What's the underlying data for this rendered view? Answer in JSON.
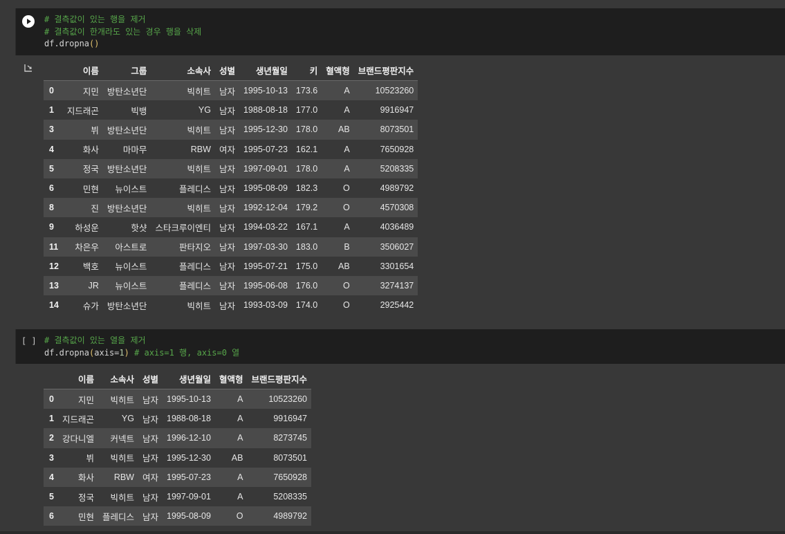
{
  "cell1": {
    "code": [
      {
        "parts": [
          {
            "t": "# 결측값이 있는 행을 제거",
            "c": "c-comment"
          }
        ]
      },
      {
        "parts": [
          {
            "t": "# 결측값이 한개라도 있는 경우 행을 삭제",
            "c": "c-comment"
          }
        ]
      },
      {
        "parts": [
          {
            "t": "df.dropna",
            "c": "c-plain"
          },
          {
            "t": "()",
            "c": "c-paren"
          }
        ]
      }
    ]
  },
  "table1": {
    "columns": [
      "",
      "이름",
      "그룹",
      "소속사",
      "성별",
      "생년월일",
      "키",
      "혈액형",
      "브랜드평판지수"
    ],
    "rows": [
      [
        "0",
        "지민",
        "방탄소년단",
        "빅히트",
        "남자",
        "1995-10-13",
        "173.6",
        "A",
        "10523260"
      ],
      [
        "1",
        "지드래곤",
        "빅뱅",
        "YG",
        "남자",
        "1988-08-18",
        "177.0",
        "A",
        "9916947"
      ],
      [
        "3",
        "뷔",
        "방탄소년단",
        "빅히트",
        "남자",
        "1995-12-30",
        "178.0",
        "AB",
        "8073501"
      ],
      [
        "4",
        "화사",
        "마마무",
        "RBW",
        "여자",
        "1995-07-23",
        "162.1",
        "A",
        "7650928"
      ],
      [
        "5",
        "정국",
        "방탄소년단",
        "빅히트",
        "남자",
        "1997-09-01",
        "178.0",
        "A",
        "5208335"
      ],
      [
        "6",
        "민현",
        "뉴이스트",
        "플레디스",
        "남자",
        "1995-08-09",
        "182.3",
        "O",
        "4989792"
      ],
      [
        "8",
        "진",
        "방탄소년단",
        "빅히트",
        "남자",
        "1992-12-04",
        "179.2",
        "O",
        "4570308"
      ],
      [
        "9",
        "하성운",
        "핫샷",
        "스타크루이엔티",
        "남자",
        "1994-03-22",
        "167.1",
        "A",
        "4036489"
      ],
      [
        "11",
        "차은우",
        "아스트로",
        "판타지오",
        "남자",
        "1997-03-30",
        "183.0",
        "B",
        "3506027"
      ],
      [
        "12",
        "백호",
        "뉴이스트",
        "플레디스",
        "남자",
        "1995-07-21",
        "175.0",
        "AB",
        "3301654"
      ],
      [
        "13",
        "JR",
        "뉴이스트",
        "플레디스",
        "남자",
        "1995-06-08",
        "176.0",
        "O",
        "3274137"
      ],
      [
        "14",
        "슈가",
        "방탄소년단",
        "빅히트",
        "남자",
        "1993-03-09",
        "174.0",
        "O",
        "2925442"
      ]
    ]
  },
  "cell2": {
    "exec_label": "[ ]",
    "code": [
      {
        "parts": [
          {
            "t": "# 결측값이 있는 열을 제거",
            "c": "c-comment"
          }
        ]
      },
      {
        "parts": [
          {
            "t": "df.dropna",
            "c": "c-plain"
          },
          {
            "t": "(",
            "c": "c-paren"
          },
          {
            "t": "axis=",
            "c": "c-plain"
          },
          {
            "t": "1",
            "c": "c-num"
          },
          {
            "t": ")",
            "c": "c-paren"
          },
          {
            "t": " # axis=1 행, axis=0 열",
            "c": "c-comment"
          }
        ]
      }
    ]
  },
  "table2": {
    "columns": [
      "",
      "이름",
      "소속사",
      "성별",
      "생년월일",
      "혈액형",
      "브랜드평판지수"
    ],
    "rows": [
      [
        "0",
        "지민",
        "빅히트",
        "남자",
        "1995-10-13",
        "A",
        "10523260"
      ],
      [
        "1",
        "지드래곤",
        "YG",
        "남자",
        "1988-08-18",
        "A",
        "9916947"
      ],
      [
        "2",
        "강다니엘",
        "커넥트",
        "남자",
        "1996-12-10",
        "A",
        "8273745"
      ],
      [
        "3",
        "뷔",
        "빅히트",
        "남자",
        "1995-12-30",
        "AB",
        "8073501"
      ],
      [
        "4",
        "화사",
        "RBW",
        "여자",
        "1995-07-23",
        "A",
        "7650928"
      ],
      [
        "5",
        "정국",
        "빅히트",
        "남자",
        "1997-09-01",
        "A",
        "5208335"
      ],
      [
        "6",
        "민현",
        "플레디스",
        "남자",
        "1995-08-09",
        "O",
        "4989792"
      ]
    ]
  }
}
